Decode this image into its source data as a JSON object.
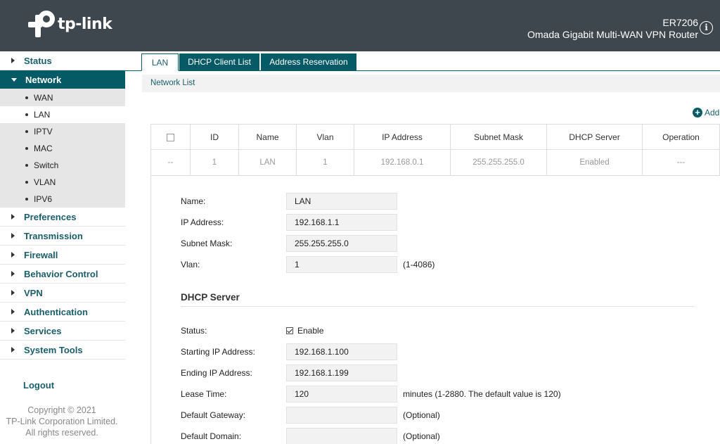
{
  "header": {
    "brand": "tp-link",
    "model": "ER7206",
    "product": "Omada Gigabit Multi-WAN VPN Router",
    "info_glyph": "i"
  },
  "sidebar": {
    "items": [
      {
        "label": "Status"
      },
      {
        "label": "Network",
        "open": true
      },
      {
        "label": "Preferences"
      },
      {
        "label": "Transmission"
      },
      {
        "label": "Firewall"
      },
      {
        "label": "Behavior Control"
      },
      {
        "label": "VPN"
      },
      {
        "label": "Authentication"
      },
      {
        "label": "Services"
      },
      {
        "label": "System Tools"
      }
    ],
    "network_sub": [
      {
        "label": "WAN"
      },
      {
        "label": "LAN",
        "active": true
      },
      {
        "label": "IPTV"
      },
      {
        "label": "MAC"
      },
      {
        "label": "Switch"
      },
      {
        "label": "VLAN"
      },
      {
        "label": "IPV6"
      }
    ],
    "logout": "Logout",
    "copyright": [
      "Copyright © 2021",
      "TP-Link Corporation Limited.",
      "All rights reserved."
    ]
  },
  "tabs": [
    {
      "label": "LAN",
      "active": true
    },
    {
      "label": "DHCP Client List"
    },
    {
      "label": "Address Reservation"
    }
  ],
  "section_title": "Network List",
  "add_label": "Add",
  "table": {
    "headers": [
      "ID",
      "Name",
      "Vlan",
      "IP Address",
      "Subnet Mask",
      "DHCP Server",
      "Operation"
    ],
    "rows": [
      [
        "--",
        "1",
        "LAN",
        "1",
        "192.168.0.1",
        "255.255.255.0",
        "Enabled",
        "---"
      ]
    ]
  },
  "form": {
    "name": {
      "label": "Name:",
      "value": "LAN"
    },
    "ip": {
      "label": "IP Address:",
      "value": "192.168.1.1"
    },
    "mask": {
      "label": "Subnet Mask:",
      "value": "255.255.255.0"
    },
    "vlan": {
      "label": "Vlan:",
      "value": "1",
      "hint": "(1-4086)"
    },
    "dhcp_title": "DHCP Server",
    "status": {
      "label": "Status:",
      "check_label": "Enable",
      "checked": true
    },
    "start_ip": {
      "label": "Starting IP Address:",
      "value": "192.168.1.100"
    },
    "end_ip": {
      "label": "Ending IP Address:",
      "value": "192.168.1.199"
    },
    "lease": {
      "label": "Lease Time:",
      "value": "120",
      "hint": "minutes (1-2880. The default value is 120)"
    },
    "gateway": {
      "label": "Default Gateway:",
      "value": "",
      "hint": "(Optional)"
    },
    "domain": {
      "label": "Default Domain:",
      "value": "",
      "hint": "(Optional)"
    }
  }
}
